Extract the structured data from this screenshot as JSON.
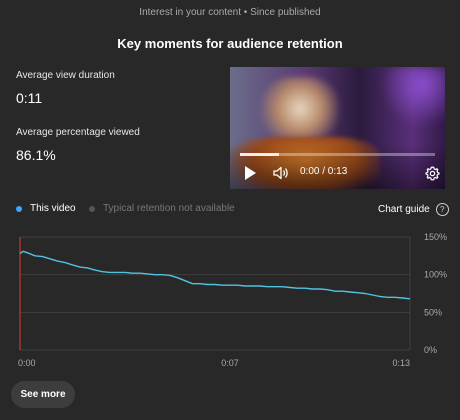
{
  "header": {
    "subtitle": "Interest in your content • Since published",
    "title": "Key moments for audience retention"
  },
  "metrics": {
    "avg_view_duration_label": "Average view duration",
    "avg_view_duration_value": "0:11",
    "avg_pct_viewed_label": "Average percentage viewed",
    "avg_pct_viewed_value": "86.1%"
  },
  "player": {
    "time_readout": "0:00 / 0:13",
    "progress_fraction": 0.2,
    "icons": [
      "play-icon",
      "volume-icon",
      "settings-gear-icon"
    ]
  },
  "legend": {
    "this_video": "This video",
    "typical": "Typical retention not available",
    "this_video_color": "#3ea6ff",
    "typical_color": "#555555",
    "chart_guide": "Chart guide",
    "help_icon": "?"
  },
  "chart_data": {
    "type": "line",
    "series": [
      {
        "name": "This video",
        "color": "#4fc3e0",
        "x": [
          0,
          0.1,
          0.25,
          0.5,
          0.75,
          1,
          1.25,
          1.5,
          1.75,
          2,
          2.25,
          2.5,
          2.75,
          3,
          3.25,
          3.5,
          3.75,
          4,
          4.25,
          4.5,
          4.75,
          5,
          5.25,
          5.5,
          5.75,
          6,
          6.25,
          6.5,
          6.75,
          7,
          7.25,
          7.5,
          7.75,
          8,
          8.25,
          8.5,
          8.75,
          9,
          9.25,
          9.5,
          9.75,
          10,
          10.25,
          10.5,
          10.75,
          11,
          11.25,
          11.5,
          11.75,
          12,
          12.25,
          12.5,
          12.75,
          13
        ],
        "y": [
          128,
          131,
          129,
          125,
          124,
          121,
          118,
          116,
          113,
          110,
          109,
          106,
          104,
          103,
          103,
          103,
          102,
          102,
          101,
          100,
          100,
          99,
          96,
          92,
          88,
          88,
          87,
          87,
          86,
          86,
          86,
          85,
          85,
          85,
          84,
          84,
          84,
          83,
          82,
          82,
          81,
          81,
          80,
          78,
          78,
          77,
          76,
          75,
          73,
          71,
          70,
          70,
          69,
          68
        ]
      }
    ],
    "xlim": [
      0,
      13
    ],
    "ylim": [
      0,
      150
    ],
    "x_tick_values": [
      0,
      7,
      13
    ],
    "x_tick_labels": [
      "0:00",
      "0:07",
      "0:13"
    ],
    "y_tick_values": [
      0,
      50,
      100,
      150
    ],
    "y_tick_labels": [
      "0%",
      "50%",
      "100%",
      "150%"
    ],
    "grid": true
  },
  "footer": {
    "see_more_label": "See more"
  }
}
